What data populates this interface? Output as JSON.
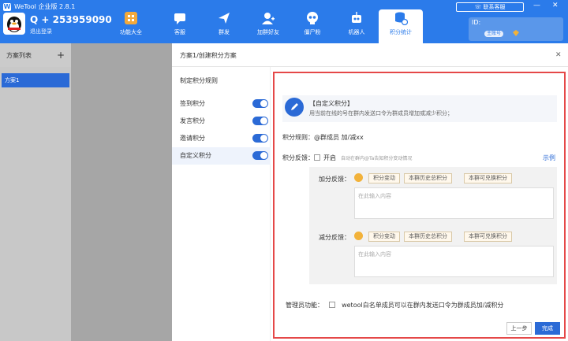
{
  "app": {
    "title": "WeTool 企业版 2.8.1",
    "contact_service": "联系客服",
    "user_name": "Q + 253959090",
    "logout": "退出登录"
  },
  "nav_tabs": [
    {
      "label": "功能大全",
      "icon": "grid-icon"
    },
    {
      "label": "客服",
      "icon": "chat-icon"
    },
    {
      "label": "群发",
      "icon": "send-icon"
    },
    {
      "label": "加群好友",
      "icon": "add-friend-icon"
    },
    {
      "label": "僵尸粉",
      "icon": "skull-icon"
    },
    {
      "label": "机器人",
      "icon": "robot-icon"
    },
    {
      "label": "积分统计",
      "icon": "stats-icon",
      "active": true
    }
  ],
  "account": {
    "id_label": "ID:",
    "badge": "主账号"
  },
  "scheme_panel": {
    "title": "方案列表",
    "add": "+",
    "items": [
      "方案1"
    ]
  },
  "dialog": {
    "title": "方案1/创建积分方案",
    "subtitle": "制定积分规则",
    "rules": [
      {
        "label": "签到积分",
        "on": true
      },
      {
        "label": "发言积分",
        "on": true
      },
      {
        "label": "邀请积分",
        "on": true
      },
      {
        "label": "自定义积分",
        "on": true,
        "selected": true
      }
    ]
  },
  "custom": {
    "title": "【自定义积分】",
    "desc": "用当前在线的号在群内发送口令为群成员增加或减少积分；",
    "rule_text": "积分规则：@群成员 加/减xx",
    "feedback_label": "积分反馈：",
    "feedback_open": "开启",
    "feedback_hint": "自动在群内@Ta告知积分变动情况",
    "example": "示例",
    "add_label": "加分反馈：",
    "sub_label": "减分反馈：",
    "tags": [
      "积分变动",
      "本群历史总积分",
      "本群可兑换积分"
    ],
    "placeholder": "在此输入内容",
    "admin_label": "管理员功能：",
    "admin_desc": "wetool白名单成员可以在群内发送口令为群成员加/减积分",
    "prev": "上一步",
    "done": "完成"
  },
  "colors": {
    "primary": "#2b7bea",
    "accent": "#2b6ad6",
    "highlight": "#e54848"
  }
}
